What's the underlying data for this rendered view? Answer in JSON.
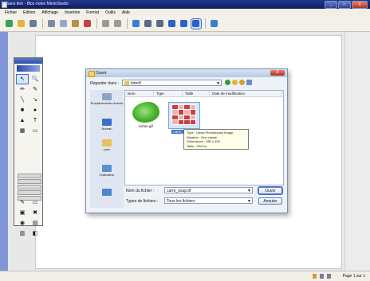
{
  "window": {
    "title": "Sans titre - Bloc-notes MimioStudio"
  },
  "window_controls": {
    "minimize": "_",
    "maximize": "□",
    "close": "X"
  },
  "menu": [
    "Fichier",
    "Edition",
    "Affichage",
    "Insertion",
    "Format",
    "Outils",
    "Aide"
  ],
  "toolbar_icons": [
    {
      "name": "home-icon",
      "color": "#3aa05a"
    },
    {
      "name": "open-folder-icon",
      "color": "#e2b53a"
    },
    {
      "name": "print-icon",
      "color": "#6c7a99"
    },
    {
      "name": "sep"
    },
    {
      "name": "cut-icon",
      "color": "#7d8aa6"
    },
    {
      "name": "copy-icon",
      "color": "#9aa8c8"
    },
    {
      "name": "paste-icon",
      "color": "#b98d4a"
    },
    {
      "name": "delete-icon",
      "color": "#c24444"
    },
    {
      "name": "sep"
    },
    {
      "name": "undo-icon",
      "color": "#9a9a9a"
    },
    {
      "name": "redo-icon",
      "color": "#9a9a9a"
    },
    {
      "name": "sep"
    },
    {
      "name": "import-icon",
      "color": "#3a7fd0"
    },
    {
      "name": "back-icon",
      "color": "#5a6a8a"
    },
    {
      "name": "forward-icon",
      "color": "#5a6a8a"
    },
    {
      "name": "zoom-in-icon",
      "color": "#2d62c8"
    },
    {
      "name": "zoom-out-icon",
      "color": "#2d62c8"
    },
    {
      "name": "zoom-fit-icon",
      "color": "#2d62c8",
      "active": true
    },
    {
      "name": "sep"
    },
    {
      "name": "screen-icon",
      "color": "#3a7fd0"
    }
  ],
  "palette_tools": [
    {
      "name": "select-arrow-icon",
      "glyph": "↖",
      "selected": true
    },
    {
      "name": "zoom-icon",
      "glyph": "🔍"
    },
    {
      "name": "pen-icon",
      "glyph": "✏"
    },
    {
      "name": "highlighter-icon",
      "glyph": "✎"
    },
    {
      "name": "line-icon",
      "glyph": "╲"
    },
    {
      "name": "arrow-line-icon",
      "glyph": "↘"
    },
    {
      "name": "rectangle-icon",
      "glyph": "■"
    },
    {
      "name": "ellipse-icon",
      "glyph": "●"
    },
    {
      "name": "triangle-icon",
      "glyph": "▲"
    },
    {
      "name": "text-icon",
      "glyph": "T"
    },
    {
      "name": "image-icon",
      "glyph": "▦"
    },
    {
      "name": "eraser-icon",
      "glyph": "▭"
    }
  ],
  "palette_tools_bottom": [
    {
      "name": "recorder-icon",
      "glyph": "✎"
    },
    {
      "name": "clear-icon",
      "glyph": "▭"
    },
    {
      "name": "gallery-icon",
      "glyph": "▣"
    },
    {
      "name": "close-tool-icon",
      "glyph": "✖"
    },
    {
      "name": "color-icon",
      "glyph": "◉"
    },
    {
      "name": "screen-tool-icon",
      "glyph": "▤"
    },
    {
      "name": "reveal-icon",
      "glyph": "▥"
    },
    {
      "name": "spotlight-icon",
      "glyph": "◧"
    }
  ],
  "dialog": {
    "title": "Ouvrir",
    "look_in_label": "Regarder dans :",
    "look_in_value": "Inter8",
    "places": [
      "Emplacements récents",
      "Bureau",
      "paul",
      "Ordinateur",
      ""
    ],
    "columns": [
      "Nom",
      "Type",
      "Taille",
      "Date de modification"
    ],
    "files": [
      {
        "name": "tortue.gif"
      },
      {
        "name": "carre_soup.tif"
      }
    ],
    "tooltip": [
      "Type : Ulead PhotoImpact Image",
      "Notation : Non classé",
      "Dimensions : 380 x 450",
      "Taille : 254 Ko"
    ],
    "filename_label": "Nom du fichier :",
    "filename_value": "carre_soup.tif",
    "filetype_label": "Types de fichiers :",
    "filetype_value": "Tous les fichiers",
    "open_button": "Ouvrir",
    "cancel_button": "Annuler"
  },
  "status": {
    "page": "Page 1 sur 1"
  }
}
